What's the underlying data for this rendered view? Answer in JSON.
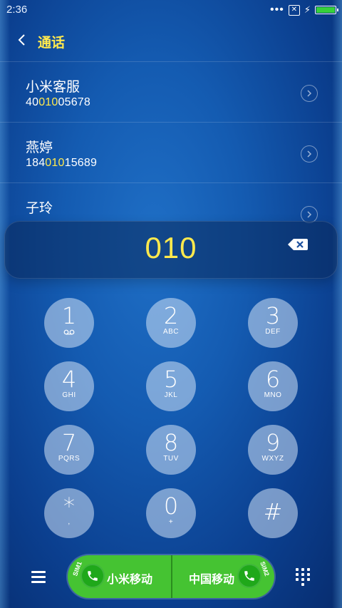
{
  "status": {
    "time": "2:36",
    "dots": "•••",
    "sim_icon": "✕",
    "bolt": "⚡"
  },
  "header": {
    "title": "通话"
  },
  "contacts": [
    {
      "name": "小米客服",
      "number_pre": "40",
      "number_hl": "010",
      "number_post": "05678"
    },
    {
      "name": "燕婷",
      "number_pre": "184",
      "number_hl": "010",
      "number_post": "15689"
    },
    {
      "name": "子玲",
      "number_pre": "",
      "number_hl": "",
      "number_post": ""
    }
  ],
  "dialer": {
    "input": "010"
  },
  "keypad": [
    {
      "digit": "1",
      "letters": ""
    },
    {
      "digit": "2",
      "letters": "ABC"
    },
    {
      "digit": "3",
      "letters": "DEF"
    },
    {
      "digit": "4",
      "letters": "GHI"
    },
    {
      "digit": "5",
      "letters": "JKL"
    },
    {
      "digit": "6",
      "letters": "MNO"
    },
    {
      "digit": "7",
      "letters": "PQRS"
    },
    {
      "digit": "8",
      "letters": "TUV"
    },
    {
      "digit": "9",
      "letters": "WXYZ"
    },
    {
      "digit": "*",
      "letters": ","
    },
    {
      "digit": "0",
      "letters": "+"
    },
    {
      "digit": "#",
      "letters": ""
    }
  ],
  "call": {
    "sim1_tag": "SIM1",
    "sim1_carrier": "小米移动",
    "sim2_tag": "SIM2",
    "sim2_carrier": "中国移动"
  },
  "colors": {
    "accent": "#ffe94d",
    "call_green": "#45c332",
    "battery": "#37d13a"
  }
}
